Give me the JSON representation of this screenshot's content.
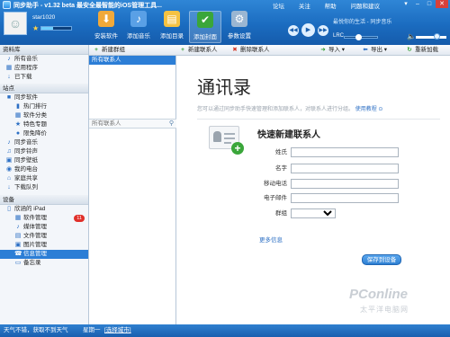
{
  "app": {
    "title": "同步助手 - v1.32 beta  最安全最智能的iOS管理工具..."
  },
  "user": {
    "name": "star1020"
  },
  "toolbar": [
    {
      "label": "安装软件",
      "icon": "download-box-icon",
      "color": "#f0a93a"
    },
    {
      "label": "添加音乐",
      "icon": "music-note-icon",
      "color": "#5aa0e6"
    },
    {
      "label": "添加目录",
      "icon": "folder-icon",
      "color": "#f5c242"
    },
    {
      "label": "添加封面",
      "icon": "checkbox-icon",
      "color": "#3aa63a"
    },
    {
      "label": "参数设置",
      "icon": "gear-icon",
      "color": "#9ab6d2"
    }
  ],
  "top_links": [
    "论坛",
    "关注",
    "帮助",
    "问题和建议"
  ],
  "player": {
    "now_playing": "最悦你的生活 - 同步音乐",
    "lrc": "LRC"
  },
  "sidebar": {
    "library": {
      "header": "资料库",
      "items": [
        {
          "label": "所有音乐",
          "icon": "music-note-icon"
        },
        {
          "label": "应用程序",
          "icon": "apps-icon"
        },
        {
          "label": "已下载",
          "icon": "download-arrow-icon"
        }
      ]
    },
    "store": {
      "header": "站点",
      "items": [
        {
          "label": "同步软件",
          "icon": "store-icon",
          "level": 0
        },
        {
          "label": "热门排行",
          "icon": "chart-icon",
          "level": 1
        },
        {
          "label": "软件分类",
          "icon": "grid-icon",
          "level": 1
        },
        {
          "label": "特色专题",
          "icon": "star-icon",
          "level": 1
        },
        {
          "label": "限免降价",
          "icon": "tag-icon",
          "level": 1
        },
        {
          "label": "同步音乐",
          "icon": "music-note-icon",
          "level": 0
        },
        {
          "label": "同步铃声",
          "icon": "bell-icon",
          "level": 0
        },
        {
          "label": "同步壁纸",
          "icon": "picture-icon",
          "level": 0
        },
        {
          "label": "我的电台",
          "icon": "radio-icon",
          "level": 0
        },
        {
          "label": "家庭共享",
          "icon": "home-icon",
          "level": 0
        },
        {
          "label": "下载队列",
          "icon": "queue-icon",
          "level": 0
        }
      ]
    },
    "device": {
      "header": "设备",
      "name": "欣涵的 iPad",
      "items": [
        {
          "label": "软件管理",
          "icon": "apps-icon",
          "badge": "11"
        },
        {
          "label": "媒体管理",
          "icon": "media-icon"
        },
        {
          "label": "文件管理",
          "icon": "folder-icon"
        },
        {
          "label": "图片管理",
          "icon": "picture-icon"
        },
        {
          "label": "信息管理",
          "icon": "contacts-icon",
          "selected": true
        },
        {
          "label": "备忘录",
          "icon": "note-icon"
        }
      ]
    }
  },
  "actions": {
    "new_group": "新建群组",
    "new_contact": "新建联系人",
    "delete_contact": "删除联系人",
    "import": "导入",
    "export": "导出",
    "refresh": "重新加载"
  },
  "contacts": {
    "selected_group": "所有联系人",
    "search_placeholder": "所有联系人"
  },
  "main": {
    "heading": "通讯录",
    "hint": "您可以通过同步助手快速管理和添加联系人，对联系人进行分组。",
    "hint_link": "使用教程"
  },
  "form": {
    "title": "快速新建联系人",
    "fields": {
      "last_name": "姓氏",
      "first_name": "名字",
      "mobile": "移动电话",
      "email": "电子邮件",
      "group": "群组"
    },
    "more": "更多信息",
    "save": "保存到设备"
  },
  "watermark": {
    "brand": "PConline",
    "sub": "太平洋电脑网"
  },
  "statusbar": {
    "weather": "天气不错，获取不到天气",
    "date": "星期一",
    "city_link": "[选择城市]"
  }
}
